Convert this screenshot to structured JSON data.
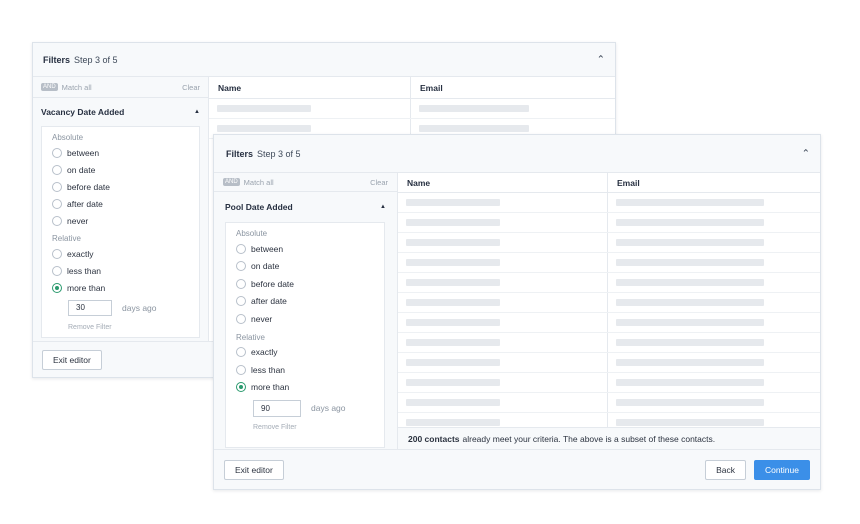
{
  "back_panel": {
    "title": "Filters",
    "step": "Step 3 of 5",
    "and_badge": "AND",
    "match_all": "Match all",
    "clear": "Clear",
    "group_title": "Vacancy Date Added",
    "absolute_label": "Absolute",
    "absolute_options": [
      "between",
      "on date",
      "before date",
      "after date",
      "never"
    ],
    "relative_label": "Relative",
    "relative_options": [
      "exactly",
      "less than",
      "more than"
    ],
    "selected_option": "more than",
    "days_value": "30",
    "days_unit": "days ago",
    "remove_filter": "Remove Filter",
    "columns": [
      "Name",
      "Email"
    ],
    "exit_editor": "Exit editor"
  },
  "front_panel": {
    "title": "Filters",
    "step": "Step 3 of 5",
    "and_badge": "AND",
    "match_all": "Match all",
    "clear": "Clear",
    "group_title": "Pool Date Added",
    "absolute_label": "Absolute",
    "absolute_options": [
      "between",
      "on date",
      "before date",
      "after date",
      "never"
    ],
    "relative_label": "Relative",
    "relative_options": [
      "exactly",
      "less than",
      "more than"
    ],
    "selected_option": "more than",
    "days_value": "90",
    "days_unit": "days ago",
    "remove_filter": "Remove Filter",
    "columns": [
      "Name",
      "Email"
    ],
    "summary_count": "200 contacts",
    "summary_text": "already meet your criteria. The above is a subset of these contacts.",
    "exit_editor": "Exit editor",
    "back": "Back",
    "continue": "Continue"
  },
  "icons": {
    "collapse": "chevron-up-icon",
    "group_caret": "caret-up-icon",
    "radio": "radio-icon"
  },
  "colors": {
    "accent": "#3b8fe8",
    "radio_selected": "#2b9a6e",
    "placeholder_bar": "#e6e9ed"
  }
}
